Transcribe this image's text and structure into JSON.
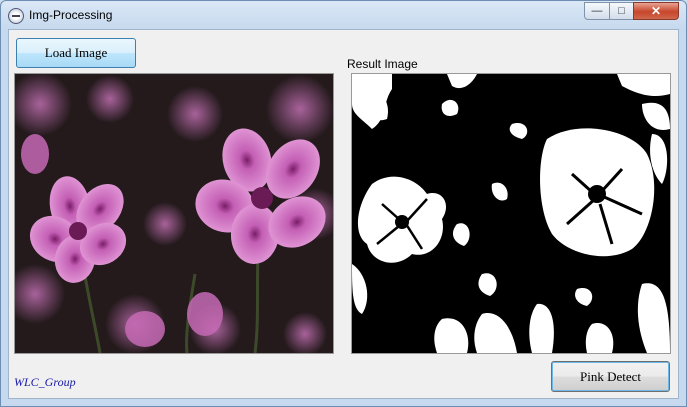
{
  "window": {
    "title": "Img-Processing",
    "minimize_symbol": "—",
    "maximize_symbol": "□",
    "close_symbol": "✕"
  },
  "toolbar": {
    "load_label": "Load Image"
  },
  "result": {
    "label": "Result Image"
  },
  "footer": {
    "brand": "WLC_Group",
    "detect_label": "Pink Detect"
  },
  "colors": {
    "petal": "#d77bc7",
    "petal_center": "#6a1a55",
    "stem": "#3d4a2a",
    "mask_fg": "#ffffff",
    "mask_bg": "#000000",
    "brand_text": "#1a1aa8"
  },
  "icons": [
    "app-icon",
    "minimize-icon",
    "maximize-icon",
    "close-icon"
  ]
}
